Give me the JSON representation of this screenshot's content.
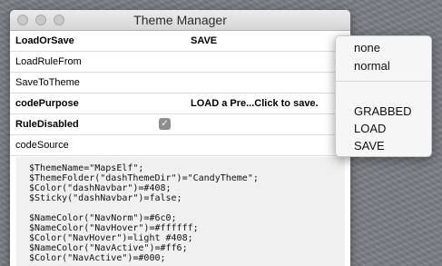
{
  "window": {
    "title": "Theme Manager"
  },
  "rows": [
    {
      "key": "LoadOrSave",
      "value": "SAVE"
    },
    {
      "key": "LoadRuleFrom",
      "value": ""
    },
    {
      "key": "SaveToTheme",
      "value": ""
    },
    {
      "key": "codePurpose",
      "value": "LOAD a Pre...Click to save."
    },
    {
      "key": "RuleDisabled",
      "checked": true
    },
    {
      "key": "codeSource",
      "value": ""
    }
  ],
  "code_lines": [
    "$ThemeName=\"MapsElf\";",
    "$ThemeFolder(\"dashThemeDir\")=\"CandyTheme\";",
    "$Color(\"dashNavbar\")=#408;",
    "$Sticky(\"dashNavbar\")=false;",
    "",
    "$NameColor(\"NavNorm\")=#6c0;",
    "$NameColor(\"NavHover\")=#ffffff;",
    "$Color(\"NavHover\")=light #408;",
    "$NameColor(\"NavActive\")=#ff6;",
    "$Color(\"NavActive\")=#000;"
  ],
  "dropdown_menu": {
    "group1": [
      "none",
      "normal"
    ],
    "group2": [
      "GRABBED",
      "LOAD",
      "SAVE"
    ]
  }
}
